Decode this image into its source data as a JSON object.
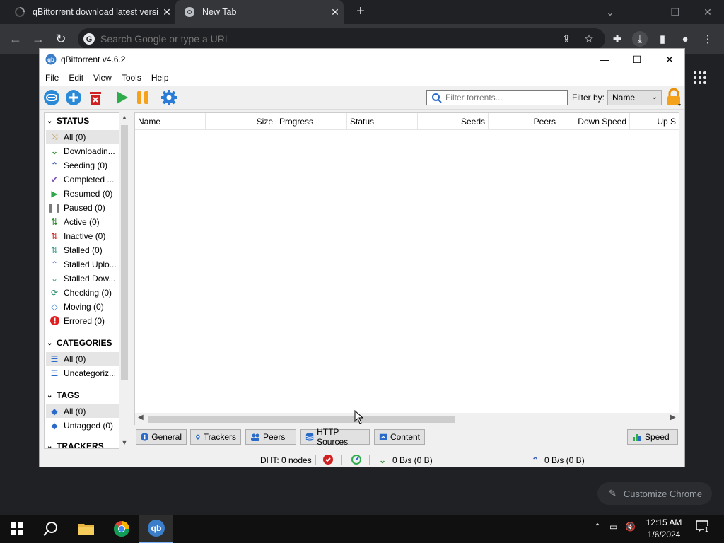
{
  "browser": {
    "tabs": [
      {
        "title": "qBittorrent download latest versi",
        "active": false
      },
      {
        "title": "New Tab",
        "active": true
      }
    ],
    "omnibox_placeholder": "Search Google or type a URL",
    "customize_label": "Customize Chrome"
  },
  "qb": {
    "title": "qBittorrent v4.6.2",
    "menu": [
      "File",
      "Edit",
      "View",
      "Tools",
      "Help"
    ],
    "filter_placeholder": "Filter torrents...",
    "filter_by_label": "Filter by:",
    "filter_by_value": "Name",
    "sidebar": {
      "status_header": "STATUS",
      "status_items": [
        {
          "label": "All (0)",
          "icon": "shuffle-icon",
          "color": "#c28a3a"
        },
        {
          "label": "Downloadin...",
          "icon": "download-chevrons-icon",
          "color": "#2e8b2e"
        },
        {
          "label": "Seeding (0)",
          "icon": "upload-chevrons-icon",
          "color": "#3d5bb8"
        },
        {
          "label": "Completed ...",
          "icon": "checkmark-icon",
          "color": "#7a52b3"
        },
        {
          "label": "Resumed (0)",
          "icon": "play-icon",
          "color": "#2ea84a"
        },
        {
          "label": "Paused (0)",
          "icon": "pause-icon",
          "color": "#7a7a7a"
        },
        {
          "label": "Active (0)",
          "icon": "updown-arrows-icon",
          "color": "#2e8b2e"
        },
        {
          "label": "Inactive (0)",
          "icon": "updown-arrows-red-icon",
          "color": "#d02020"
        },
        {
          "label": "Stalled (0)",
          "icon": "stalled-arrows-icon",
          "color": "#3a9a8a"
        },
        {
          "label": "Stalled Uplo...",
          "icon": "stalled-upload-icon",
          "color": "#5a7ad8"
        },
        {
          "label": "Stalled Dow...",
          "icon": "stalled-download-icon",
          "color": "#3aa06a"
        },
        {
          "label": "Checking (0)",
          "icon": "refresh-icon",
          "color": "#2e8b6e"
        },
        {
          "label": "Moving (0)",
          "icon": "move-icon",
          "color": "#2a7ad8"
        },
        {
          "label": "Errored (0)",
          "icon": "error-icon",
          "color": "#e02020"
        }
      ],
      "categories_header": "CATEGORIES",
      "category_items": [
        {
          "label": "All (0)",
          "icon": "list-icon"
        },
        {
          "label": "Uncategoriz...",
          "icon": "list-icon"
        }
      ],
      "tags_header": "TAGS",
      "tag_items": [
        {
          "label": "All (0)",
          "icon": "tag-icon"
        },
        {
          "label": "Untagged (0)",
          "icon": "tag-icon"
        }
      ],
      "trackers_header": "TRACKERS"
    },
    "columns": [
      "Name",
      "Size",
      "Progress",
      "Status",
      "Seeds",
      "Peers",
      "Down Speed",
      "Up S"
    ],
    "bottom_tabs": [
      "General",
      "Trackers",
      "Peers",
      "HTTP Sources",
      "Content"
    ],
    "speed_button": "Speed",
    "statusbar": {
      "dht": "DHT: 0 nodes",
      "down": "0 B/s (0 B)",
      "up": "0 B/s (0 B)"
    }
  },
  "taskbar": {
    "time": "12:15 AM",
    "date": "1/6/2024",
    "notification_count": "1"
  }
}
